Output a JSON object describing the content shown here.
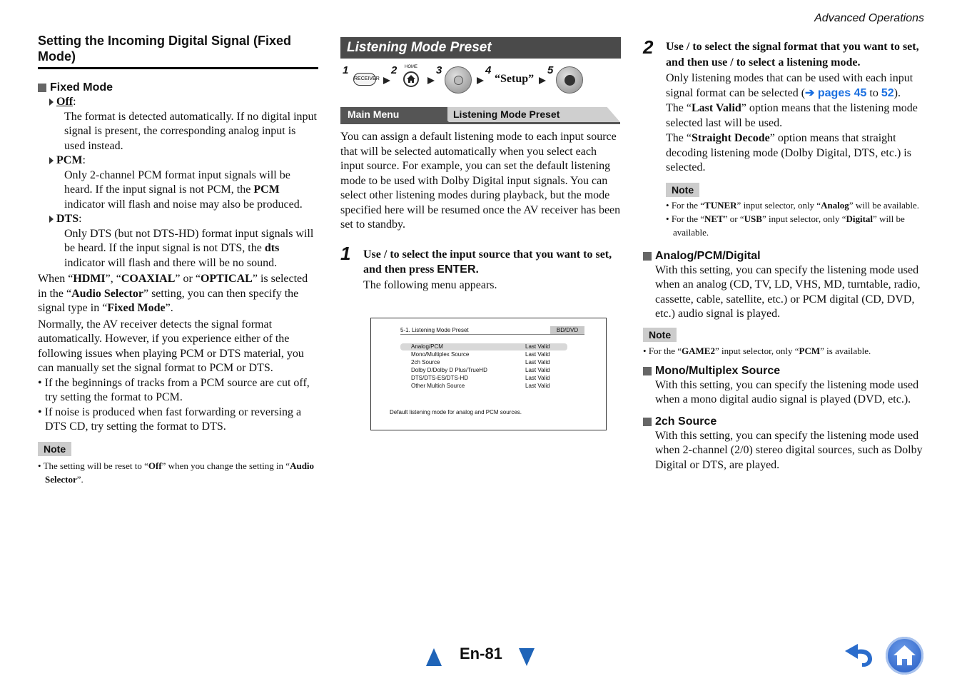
{
  "header": {
    "section": "Advanced Operations"
  },
  "left": {
    "title": "Setting the Incoming Digital Signal (Fixed Mode)",
    "fixed_mode_heading": "Fixed Mode",
    "options": [
      {
        "label": "Off",
        "text": "The format is detected automatically. If no digital input signal is present, the corresponding analog input is used instead."
      },
      {
        "label": "PCM",
        "text_pre": "Only 2-channel PCM format input signals will be heard. If the input signal is not PCM, the ",
        "text_bold": "PCM",
        "text_post": " indicator will flash and noise may also be produced."
      },
      {
        "label": "DTS",
        "text_pre": "Only DTS (but not DTS-HD) format input signals will be heard. If the input signal is not DTS, the ",
        "text_bold": "dts",
        "text_post": " indicator will flash and there will be no sound."
      }
    ],
    "para1": {
      "a": "When “",
      "b1": "HDMI",
      "c": "”, “",
      "b2": "COAXIAL",
      "d": "” or “",
      "b3": "OPTICAL",
      "e": "” is selected in the “",
      "b4": "Audio Selector",
      "f": "” setting, you can then specify the signal type in “",
      "b5": "Fixed Mode",
      "g": "”."
    },
    "para2": "Normally, the AV receiver detects the signal format automatically. However, if you experience either of the following issues when playing PCM or DTS material, you can manually set the signal format to PCM or DTS.",
    "bullets": [
      "If the beginnings of tracks from a PCM source are cut off, try setting the format to PCM.",
      "If noise is produced when fast forwarding or reversing a DTS CD, try setting the format to DTS."
    ],
    "note_label": "Note",
    "note": {
      "a": "The setting will be reset to “",
      "b1": "Off",
      "c": "” when you change the setting in “",
      "b2": "Audio Selector",
      "d": "”."
    }
  },
  "middle": {
    "banner": "Listening Mode Preset",
    "steps": {
      "n1": "1",
      "n2": "2",
      "n3": "3",
      "n4": "4",
      "n5": "5",
      "receiver_label": "RECEIVER",
      "home_label": "HOME",
      "setup_label": "“Setup”"
    },
    "breadcrumb": {
      "main": "Main Menu",
      "sub": "Listening Mode Preset"
    },
    "intro": "You can assign a default listening mode to each input source that will be selected automatically when you select each input source. For example, you can set the default listening mode to be used with Dolby Digital input signals. You can select other listening modes during playback, but the mode specified here will be resumed once the AV receiver has been set to standby.",
    "step1": {
      "num": "1",
      "title_a": "Use    /    to select the input source that you want to set, and then press ",
      "title_enter": "ENTER.",
      "body": "The following menu appears."
    },
    "menu": {
      "title": "5-1. Listening Mode Preset",
      "badge": "BD/DVD",
      "rows": [
        {
          "name": "Analog/PCM",
          "value": "Last Valid"
        },
        {
          "name": "Mono/Multiplex Source",
          "value": "Last Valid"
        },
        {
          "name": "2ch Source",
          "value": "Last Valid"
        },
        {
          "name": "Dolby D/Dolby D Plus/TrueHD",
          "value": "Last Valid"
        },
        {
          "name": "DTS/DTS-ES/DTS-HD",
          "value": "Last Valid"
        },
        {
          "name": "Other Multich Source",
          "value": "Last Valid"
        }
      ],
      "footer": "Default listening mode for analog and PCM sources."
    }
  },
  "right": {
    "step2": {
      "num": "2",
      "title": "Use    /    to select the signal format that you want to set, and then use    /    to select a listening mode.",
      "p1_pre": "Only listening modes that can be used with each input signal format can be selected (",
      "p1_link": "➔ pages 45",
      "p1_mid": " to ",
      "p1_link2": "52",
      "p1_post": ").",
      "p2_a": "The “",
      "p2_b": "Last Valid",
      "p2_c": "” option means that the listening mode selected last will be used.",
      "p3_a": "The “",
      "p3_b": "Straight Decode",
      "p3_c": "” option means that straight decoding listening mode (Dolby Digital, DTS, etc.) is selected."
    },
    "note1_label": "Note",
    "note1_items": [
      {
        "a": "For the “",
        "b1": "TUNER",
        "c": "” input selector, only “",
        "b2": "Analog",
        "d": "” will be available."
      },
      {
        "a": "For the “",
        "b1": "NET",
        "c": "” or “",
        "b2": "USB",
        "d": "” input selector, only “",
        "b3": "Digital",
        "e": "” will be available."
      }
    ],
    "analog_heading": "Analog/PCM/Digital",
    "analog_text": "With this setting, you can specify the listening mode used when an analog (CD, TV, LD, VHS, MD, turntable, radio, cassette, cable, satellite, etc.) or PCM digital (CD, DVD, etc.) audio signal is played.",
    "note2_label": "Note",
    "note2": {
      "a": "For the “",
      "b1": "GAME2",
      "c": "” input selector, only “",
      "b2": "PCM",
      "d": "” is available."
    },
    "mono_heading": "Mono/Multiplex Source",
    "mono_text": "With this setting, you can specify the listening mode used when a mono digital audio signal is played (DVD, etc.).",
    "twoch_heading": "2ch Source",
    "twoch_text": "With this setting, you can specify the listening mode used when 2-channel (2/0) stereo digital sources, such as Dolby Digital or DTS, are played."
  },
  "footer": {
    "page_number": "En-81",
    "colors": {
      "nav": "#1f64b8",
      "link": "#1a6fe0"
    }
  }
}
